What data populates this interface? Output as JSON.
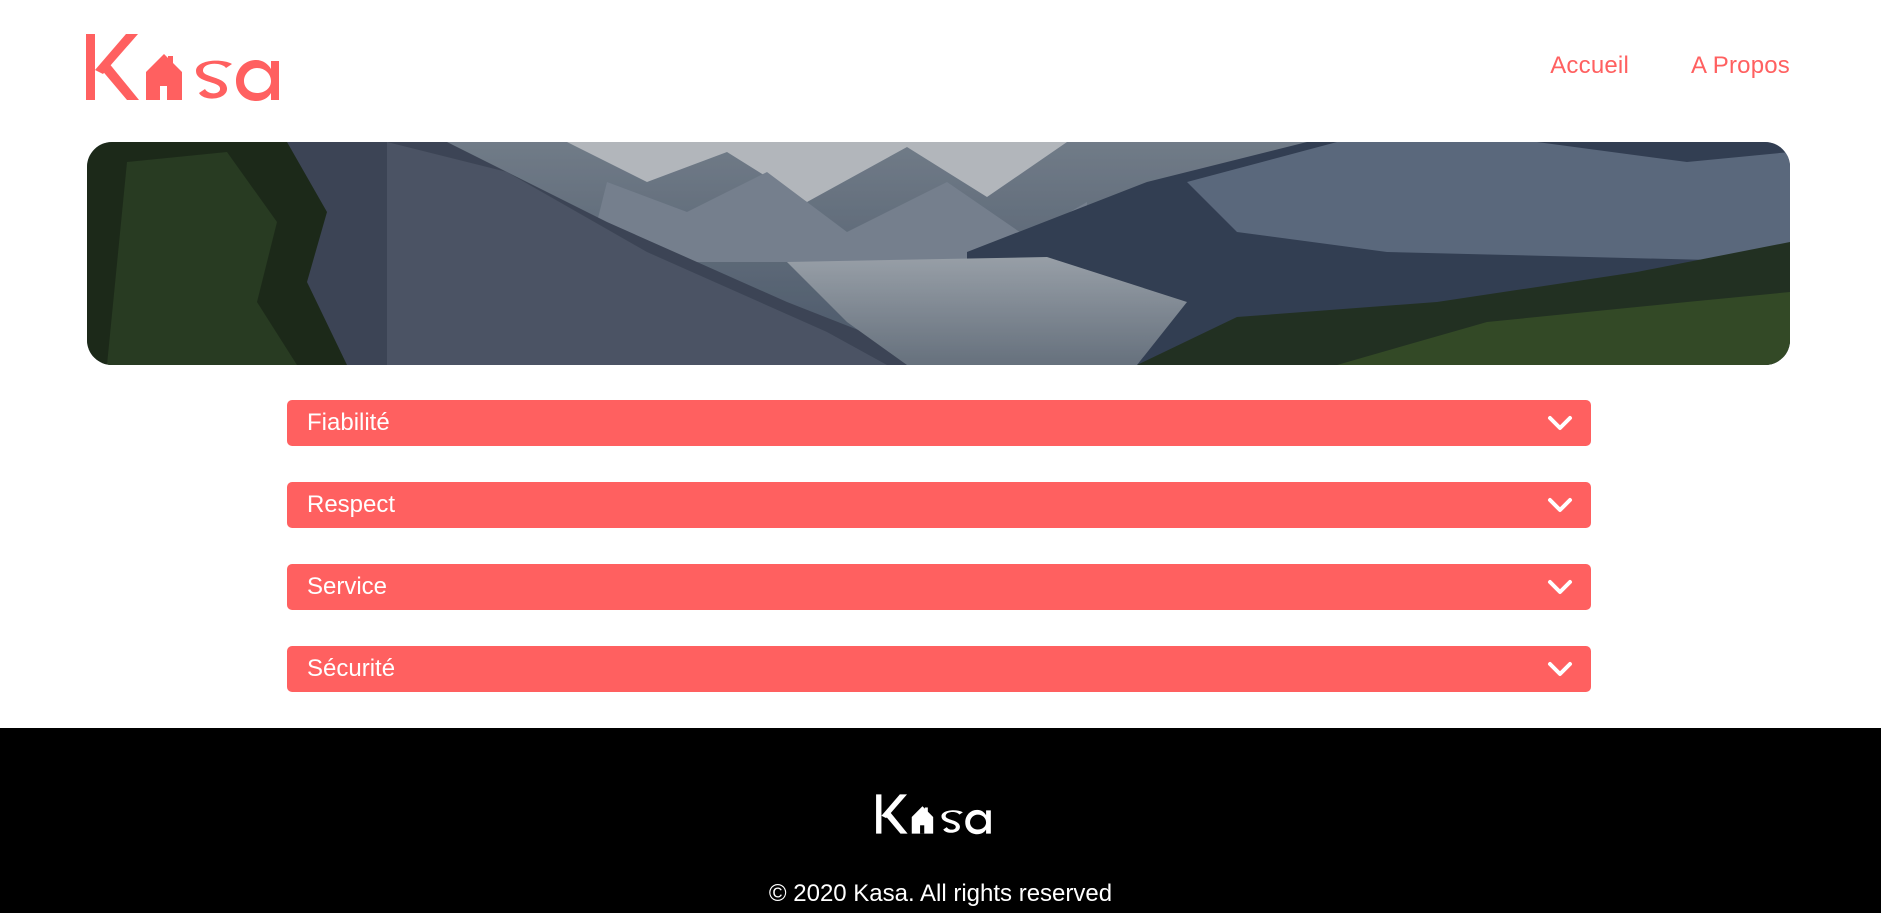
{
  "brand": {
    "name": "Kasa",
    "color": "#FF6060"
  },
  "nav": {
    "items": [
      {
        "label": "Accueil"
      },
      {
        "label": "A Propos"
      }
    ]
  },
  "banner": {
    "image": "mountain-valley-landscape"
  },
  "accordions": [
    {
      "title": "Fiabilité",
      "icon": "chevron-down-icon"
    },
    {
      "title": "Respect",
      "icon": "chevron-down-icon"
    },
    {
      "title": "Service",
      "icon": "chevron-down-icon"
    },
    {
      "title": "Sécurité",
      "icon": "chevron-down-icon"
    }
  ],
  "footer": {
    "copyright": "© 2020 Kasa. All rights reserved",
    "background": "#000000"
  }
}
